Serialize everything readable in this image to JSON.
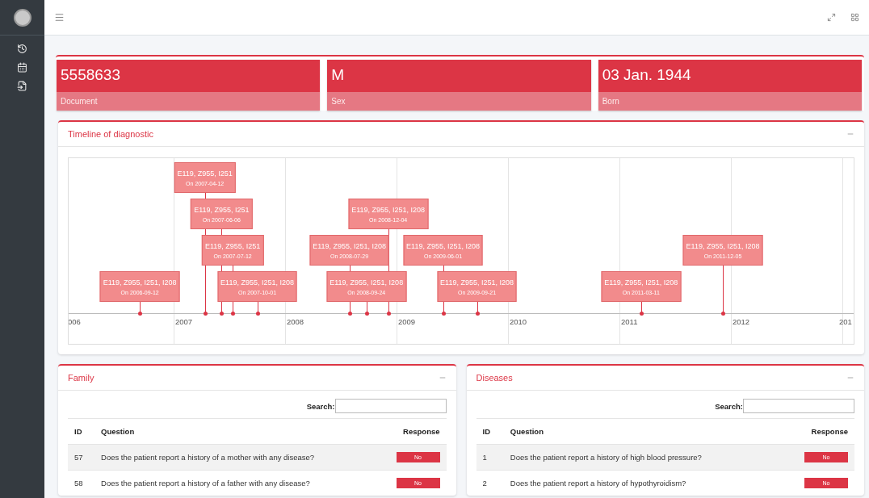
{
  "info_boxes": [
    {
      "value": "5558633",
      "label": "Document"
    },
    {
      "value": "M",
      "label": "Sex"
    },
    {
      "value": "03 Jan. 1944",
      "label": "Born"
    }
  ],
  "timeline": {
    "title": "Timeline of diagnostic",
    "axis_labels": [
      "006",
      "2007",
      "2008",
      "2009",
      "2010",
      "2011",
      "2012",
      "201"
    ],
    "lanes": [
      [
        {
          "codes": "E119, Z955, I251",
          "date": "On 2007-04-12"
        }
      ],
      [
        {
          "codes": "E119, Z955, I251",
          "date": "On 2007-06-06"
        },
        {
          "codes": "E119, Z955, I251, I208",
          "date": "On 2008-12-04"
        }
      ],
      [
        {
          "codes": "E119, Z955, I251",
          "date": "On 2007-07-12"
        },
        {
          "codes": "E119, Z955, I251, I208",
          "date": "On 2008-07-29"
        },
        {
          "codes": "E119, Z955, I251, I208",
          "date": "On 2009-06-01"
        },
        {
          "codes": "E119, Z955, I251, I208",
          "date": "On 2011-12-05"
        }
      ],
      [
        {
          "codes": "E119, Z955, I251, I208",
          "date": "On 2006-09-12"
        },
        {
          "codes": "E119, Z955, I251, I208",
          "date": "On 2007-10-01"
        },
        {
          "codes": "E119, Z955, I251, I208",
          "date": "On 2008-09-24"
        },
        {
          "codes": "E119, Z955, I251, I208",
          "date": "On 2009-09-21"
        },
        {
          "codes": "E119, Z955, I251, I208",
          "date": "On 2011-03-11"
        }
      ]
    ]
  },
  "tables": [
    {
      "title": "Family",
      "search_label": "Search:",
      "columns": [
        "ID",
        "Question",
        "Response"
      ],
      "rows": [
        {
          "id": "57",
          "question": "Does the patient report a history of a mother with any disease?",
          "response": "No"
        },
        {
          "id": "58",
          "question": "Does the patient report a history of a father with any disease?",
          "response": "No"
        }
      ]
    },
    {
      "title": "Diseases",
      "search_label": "Search:",
      "columns": [
        "ID",
        "Question",
        "Response"
      ],
      "rows": [
        {
          "id": "1",
          "question": "Does the patient report a history of high blood pressure?",
          "response": "No"
        },
        {
          "id": "2",
          "question": "Does the patient report a history of hypothyroidism?",
          "response": "No"
        }
      ]
    }
  ]
}
